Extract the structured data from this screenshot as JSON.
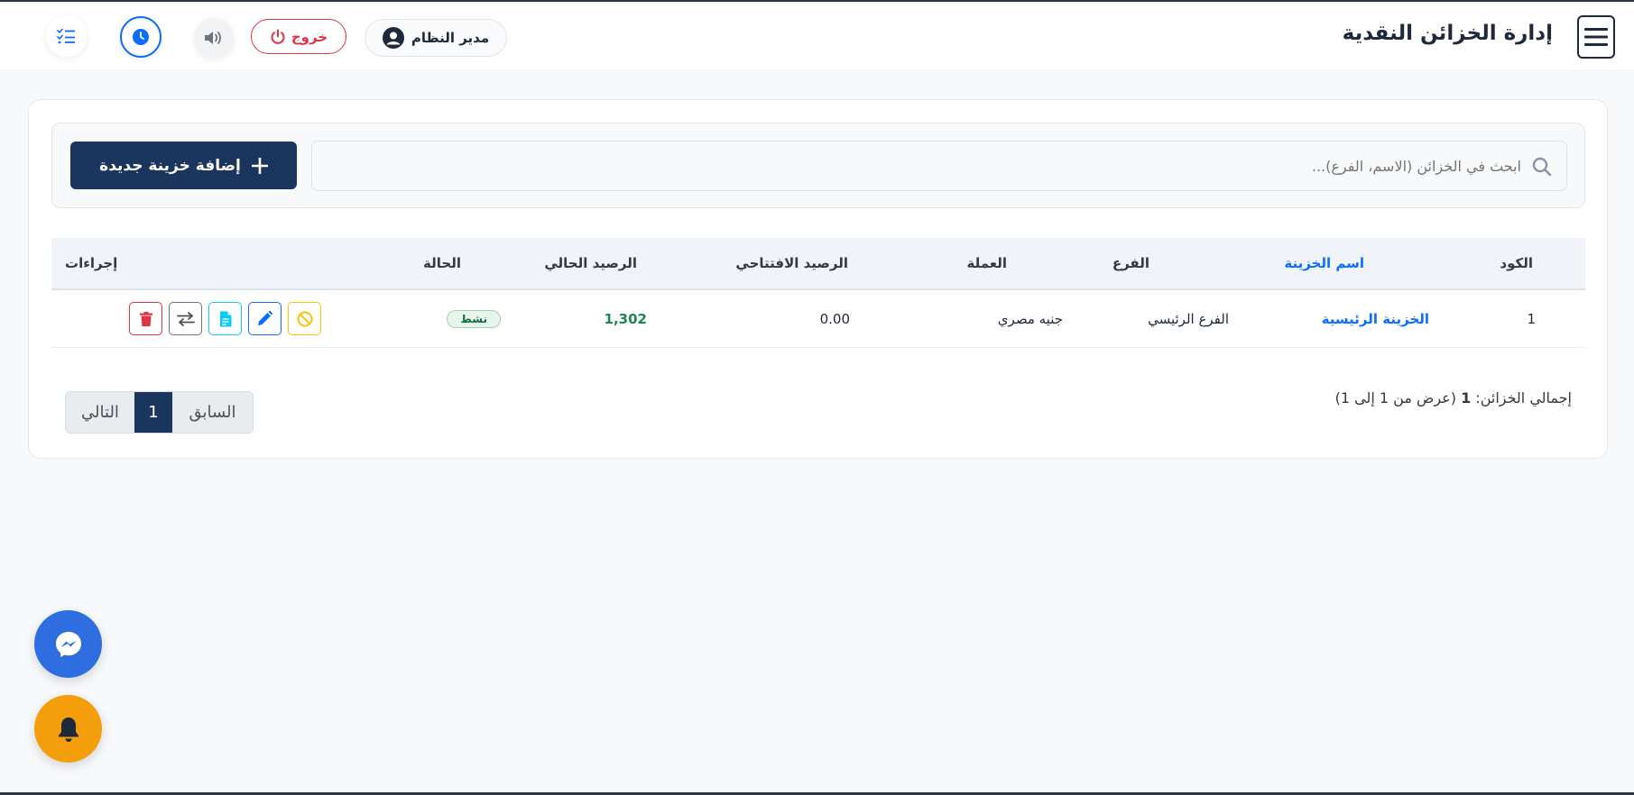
{
  "header": {
    "title": "إدارة الخزائن النقدية",
    "user_label": "مدير النظام",
    "logout_label": "خروج",
    "icons": [
      "menu-icon",
      "user-icon",
      "power-icon",
      "volume-icon",
      "clock-icon",
      "tasks-icon"
    ]
  },
  "toolbar": {
    "search_placeholder": "ابحث في الخزائن (الاسم، الفرع)...",
    "add_label": "إضافة خزينة جديدة"
  },
  "table": {
    "columns": [
      "الكود",
      "اسم الخزينة",
      "الفرع",
      "العملة",
      "الرصيد الافتتاحي",
      "الرصيد الحالي",
      "الحالة",
      "إجراءات"
    ],
    "rows": [
      {
        "code": "1",
        "name": "الخزينة الرئيسية",
        "branch": "الفرع الرئيسي",
        "currency": "جنيه مصري",
        "opening_balance": "0.00",
        "current_balance": "1,302",
        "status": "نشط"
      }
    ]
  },
  "footer": {
    "summary_prefix": "إجمالي الخزائن:",
    "summary_count": "1",
    "summary_suffix": "(عرض من 1 إلى 1)",
    "pagination": {
      "prev_label": "السابق",
      "current_page": "1",
      "next_label": "التالي"
    }
  },
  "colors": {
    "primary": "#1b365d",
    "link": "#0d6efd",
    "danger": "#dc3545",
    "success": "#198754",
    "warning": "#ffc107",
    "info": "#0dcaf0"
  }
}
